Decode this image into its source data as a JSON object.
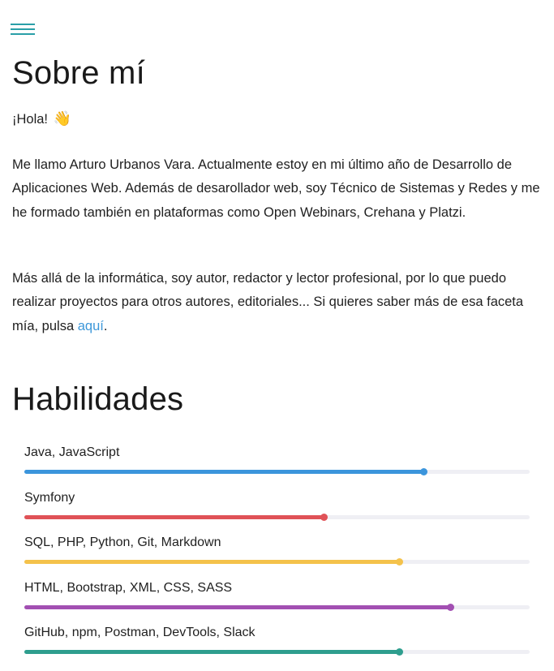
{
  "about": {
    "title": "Sobre mí",
    "greeting": "¡Hola!",
    "greeting_emoji": "👋",
    "paragraph1": "Me llamo Arturo Urbanos Vara. Actualmente estoy en mi último año de Desarrollo de Aplicaciones Web. Además de desarollador web, soy Técnico de Sistemas y Redes y me he formado también en plataformas como Open Webinars, Crehana y Platzi.",
    "paragraph2_before_link": "Más allá de la informática, soy autor, redactor y lector profesional, por lo que puedo realizar proyectos para otros autores, editoriales... Si quieres saber más de esa faceta mía, pulsa ",
    "paragraph2_link": "aquí",
    "paragraph2_after_link": ".",
    "link_color": "#3c97d9"
  },
  "skills": {
    "title": "Habilidades",
    "items": [
      {
        "label": "Java, JavaScript",
        "level": 0.79,
        "color": "#3b95dc"
      },
      {
        "label": "Symfony",
        "level": 0.593,
        "color": "#e05257"
      },
      {
        "label": "SQL, PHP, Python, Git, Markdown",
        "level": 0.742,
        "color": "#f4c24b"
      },
      {
        "label": "HTML, Bootstrap, XML, CSS, SASS",
        "level": 0.843,
        "color": "#a24fb2"
      },
      {
        "label": "GitHub, npm, Postman, DevTools, Slack",
        "level": 0.742,
        "color": "#2e9e8e"
      }
    ]
  },
  "menu": {
    "icon": "hamburger-menu-icon",
    "color": "#2a9fa8"
  }
}
